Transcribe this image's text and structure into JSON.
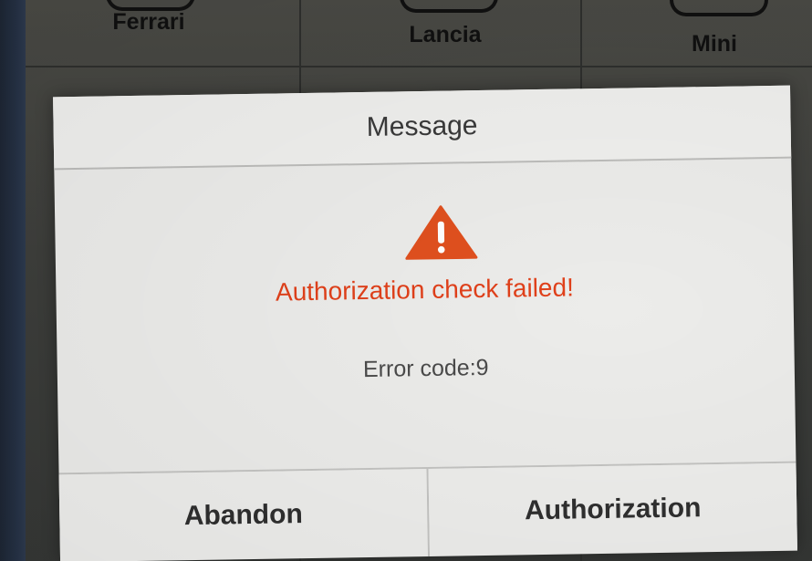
{
  "background": {
    "brands": [
      {
        "label": "Ferrari"
      },
      {
        "label": "Lancia"
      },
      {
        "label": "Mini"
      }
    ]
  },
  "dialog": {
    "title": "Message",
    "icon": "warning-triangle-icon",
    "alert_text": "Authorization check failed!",
    "alert_color": "#e0401a",
    "icon_color": "#e0501e",
    "error_code": "Error code:9",
    "buttons": {
      "abandon": "Abandon",
      "authorization": "Authorization"
    }
  }
}
